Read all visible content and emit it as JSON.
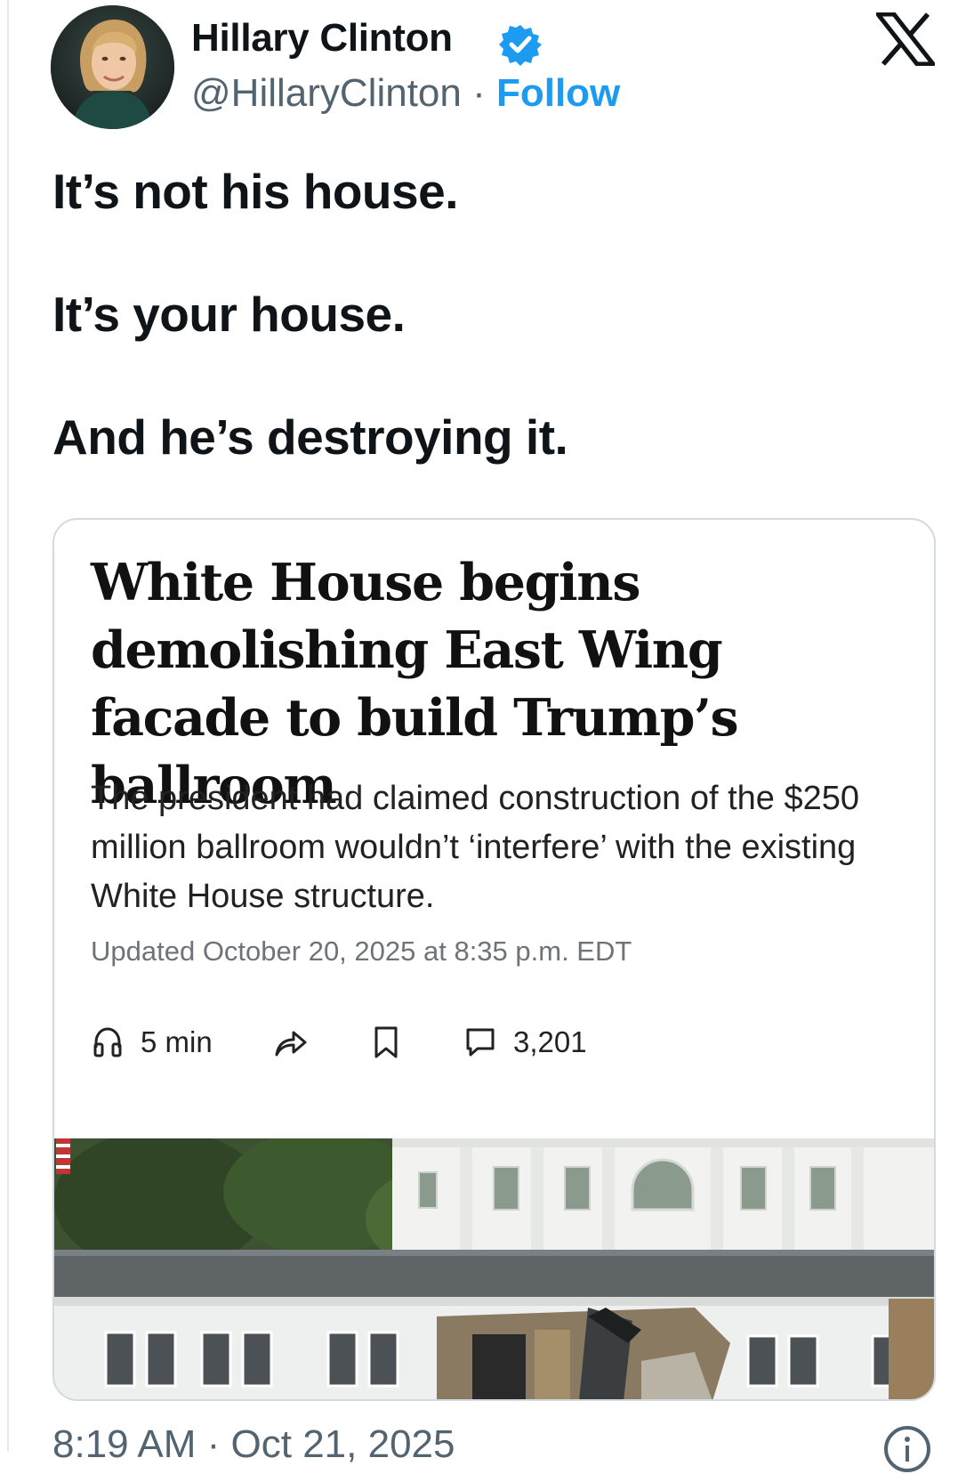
{
  "author": {
    "name": "Hillary Clinton",
    "handle": "@HillaryClinton",
    "separator": " · ",
    "follow_label": "Follow",
    "verified": true
  },
  "platform": {
    "logo_icon": "x-logo-icon"
  },
  "tweet": {
    "lines": [
      "It’s not his house.",
      "It’s your house.",
      "And he’s destroying it."
    ]
  },
  "card": {
    "headline": "White House begins demolishing East Wing facade to build Trump’s ballroom",
    "subheadline": "The president had claimed construction of the $250 million ballroom wouldn’t ‘interfere’ with the existing White House structure.",
    "updated": "Updated October 20, 2025 at 8:35 p.m. EDT",
    "actions": {
      "listen_label": "5 min",
      "comments_count": "3,201"
    },
    "image_alt": "White House East Wing facade being demolished"
  },
  "footer": {
    "timestamp": "8:19 AM · Oct 21, 2025"
  },
  "colors": {
    "accent": "#1d9bf0",
    "text": "#0f1419",
    "muted": "#536471"
  }
}
